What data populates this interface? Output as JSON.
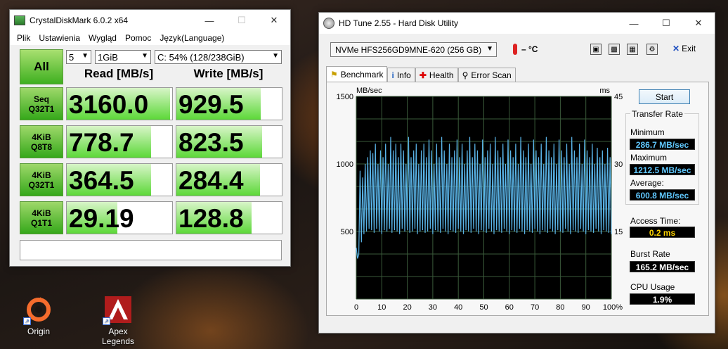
{
  "cdm": {
    "title": "CrystalDiskMark 6.0.2 x64",
    "menu": [
      "Plik",
      "Ustawienia",
      "Wygląd",
      "Pomoc",
      "Język(Language)"
    ],
    "all_label": "All",
    "count": "5",
    "size": "1GiB",
    "drive": "C: 54% (128/238GiB)",
    "read_header": "Read [MB/s]",
    "write_header": "Write [MB/s]",
    "tests": [
      {
        "l1": "Seq",
        "l2": "Q32T1",
        "read": "3160.0",
        "write": "929.5",
        "read_frac": 0.98,
        "write_frac": 0.8
      },
      {
        "l1": "4KiB",
        "l2": "Q8T8",
        "read": "778.7",
        "write": "823.5",
        "read_frac": 0.8,
        "write_frac": 0.81
      },
      {
        "l1": "4KiB",
        "l2": "Q32T1",
        "read": "364.5",
        "write": "284.4",
        "read_frac": 0.8,
        "write_frac": 0.79
      },
      {
        "l1": "4KiB",
        "l2": "Q1T1",
        "read": "29.19",
        "write": "128.8",
        "read_frac": 0.48,
        "write_frac": 0.71
      }
    ]
  },
  "hdt": {
    "title": "HD Tune 2.55 - Hard Disk Utility",
    "drive": "NVMe    HFS256GD9MNE-620 (256 GB)",
    "temp": "– °C",
    "exit_label": "Exit",
    "tabs": [
      "Benchmark",
      "Info",
      "Health",
      "Error Scan"
    ],
    "start_label": "Start",
    "transfer_rate_label": "Transfer Rate",
    "minimum_label": "Minimum",
    "minimum": "286.7 MB/sec",
    "maximum_label": "Maximum",
    "maximum": "1212.5 MB/sec",
    "average_label": "Average:",
    "average": "600.8 MB/sec",
    "access_label": "Access Time:",
    "access": "0.2 ms",
    "burst_label": "Burst Rate",
    "burst": "165.2 MB/sec",
    "cpu_label": "CPU Usage",
    "cpu": "1.9%"
  },
  "chart_data": {
    "type": "line",
    "ylabel": "MB/sec",
    "y2label": "ms",
    "ylim": [
      0,
      1500
    ],
    "y2lim": [
      0,
      45
    ],
    "y_ticks": [
      "1500",
      "1000",
      "500"
    ],
    "y2_ticks": [
      "45",
      "30",
      "15"
    ],
    "x_ticks": [
      "0",
      "10",
      "20",
      "30",
      "40",
      "50",
      "60",
      "70",
      "80",
      "90",
      "100%"
    ],
    "xlim": [
      0,
      100
    ],
    "grid": true,
    "colors": {
      "background": "#000000",
      "grid": "#3a5a3a",
      "line": "#5ab4e8"
    },
    "series": [
      {
        "x": [
          0,
          0.5,
          1,
          1.5,
          2,
          2.5,
          3,
          3.5,
          4,
          4.5,
          5,
          5.5,
          6,
          6.5,
          7,
          7.5,
          8,
          8.5,
          9,
          9.5,
          10,
          10.5,
          11,
          11.5,
          12,
          12.5,
          13,
          13.5,
          14,
          14.5,
          15,
          15.5,
          16,
          16.5,
          17,
          17.5,
          18,
          18.5,
          19,
          19.5,
          20,
          20.5,
          21,
          21.5,
          22,
          22.5,
          23,
          23.5,
          24,
          24.5,
          25,
          25.5,
          26,
          26.5,
          27,
          27.5,
          28,
          28.5,
          29,
          29.5,
          30,
          30.5,
          31,
          31.5,
          32,
          32.5,
          33,
          33.5,
          34,
          34.5,
          35,
          35.5,
          36,
          36.5,
          37,
          37.5,
          38,
          38.5,
          39,
          39.5,
          40,
          40.5,
          41,
          41.5,
          42,
          42.5,
          43,
          43.5,
          44,
          44.5,
          45,
          45.5,
          46,
          46.5,
          47,
          47.5,
          48,
          48.5,
          49,
          49.5,
          50,
          50.5,
          51,
          51.5,
          52,
          52.5,
          53,
          53.5,
          54,
          54.5,
          55,
          55.5,
          56,
          56.5,
          57,
          57.5,
          58,
          58.5,
          59,
          59.5,
          60,
          60.5,
          61,
          61.5,
          62,
          62.5,
          63,
          63.5,
          64,
          64.5,
          65,
          65.5,
          66,
          66.5,
          67,
          67.5,
          68,
          68.5,
          69,
          69.5,
          70,
          70.5,
          71,
          71.5,
          72,
          72.5,
          73,
          73.5,
          74,
          74.5,
          75,
          75.5,
          76,
          76.5,
          77,
          77.5,
          78,
          78.5,
          79,
          79.5,
          80,
          80.5,
          81,
          81.5,
          82,
          82.5,
          83,
          83.5,
          84,
          84.5,
          85,
          85.5,
          86,
          86.5,
          87,
          87.5,
          88,
          88.5,
          89,
          89.5,
          90,
          90.5,
          91,
          91.5,
          92,
          92.5,
          93,
          93.5,
          94,
          94.5,
          95,
          95.5,
          96,
          96.5,
          97,
          97.5,
          98,
          98.5,
          99,
          99.5,
          100
        ],
        "y": [
          380,
          300,
          330,
          950,
          420,
          900,
          480,
          1000,
          500,
          1050,
          520,
          1100,
          510,
          1080,
          490,
          1150,
          520,
          1000,
          500,
          1100,
          480,
          1050,
          510,
          1150,
          500,
          1000,
          520,
          1200,
          490,
          1100,
          510,
          1150,
          500,
          1050,
          480,
          1150,
          520,
          1100,
          500,
          1000,
          510,
          1200,
          490,
          1050,
          500,
          1100,
          520,
          1150,
          480,
          1000,
          500,
          1100,
          510,
          1150,
          490,
          1050,
          500,
          1180,
          520,
          1100,
          480,
          1000,
          510,
          1150,
          500,
          1050,
          490,
          1200,
          520,
          1100,
          500,
          1000,
          480,
          1150,
          510,
          1050,
          500,
          1100,
          490,
          1180,
          520,
          1050,
          500,
          1150,
          480,
          1000,
          510,
          1100,
          500,
          1200,
          490,
          1050,
          520,
          1150,
          500,
          1100,
          480,
          1000,
          510,
          1180,
          500,
          1050,
          490,
          1100,
          520,
          1150,
          500,
          1000,
          480,
          1200,
          510,
          1100,
          500,
          1050,
          490,
          1150,
          520,
          1000,
          500,
          1180,
          480,
          1100,
          510,
          1050,
          500,
          1150,
          490,
          1000,
          520,
          1200,
          500,
          1100,
          480,
          1050,
          510,
          1150,
          500,
          1000,
          490,
          1180,
          520,
          1100,
          500,
          1050,
          480,
          1150,
          510,
          1000,
          500,
          1200,
          490,
          1100,
          520,
          1050,
          500,
          1150,
          480,
          1000,
          510,
          1180,
          500,
          1100,
          490,
          1050,
          520,
          1150,
          500,
          1000,
          480,
          1200,
          510,
          1100,
          500,
          1050,
          490,
          1150,
          520,
          1000,
          500,
          1180,
          480,
          1100,
          510,
          1050,
          500,
          1150,
          490,
          1000,
          520,
          1120,
          500,
          1050,
          480,
          1100,
          510,
          1000,
          500,
          1120,
          490,
          1050,
          480
        ]
      }
    ]
  },
  "desktop": [
    {
      "label": "Origin"
    },
    {
      "label": "Apex Legends"
    }
  ]
}
